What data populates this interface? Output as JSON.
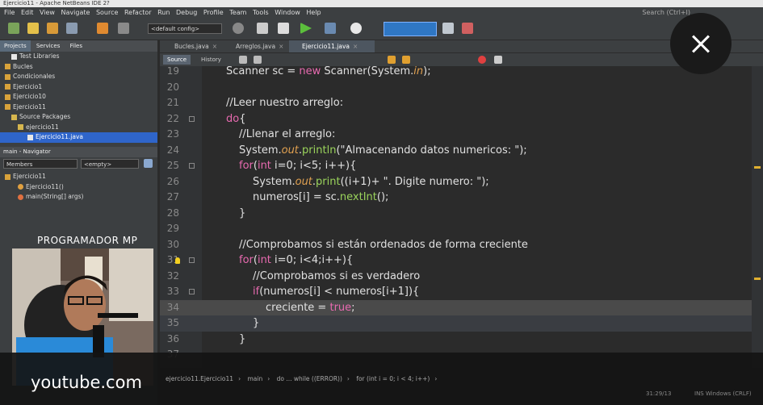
{
  "window": {
    "title": "Ejercicio11 - Apache NetBeans IDE 2?"
  },
  "menu": {
    "items": [
      "File",
      "Edit",
      "View",
      "Navigate",
      "Source",
      "Refactor",
      "Run",
      "Debug",
      "Profile",
      "Team",
      "Tools",
      "Window",
      "Help"
    ],
    "search_placeholder": "Search (Ctrl+I)"
  },
  "toolbar": {
    "config_value": "<default config>"
  },
  "projects_panel": {
    "tabs": [
      "Projects",
      "Services",
      "Files"
    ],
    "tree": [
      {
        "label": "Test Libraries",
        "type": "folder",
        "indent": 1
      },
      {
        "label": "Bucles",
        "type": "project",
        "indent": 0
      },
      {
        "label": "Condicionales",
        "type": "project",
        "indent": 0
      },
      {
        "label": "Ejercicio1",
        "type": "project",
        "indent": 0
      },
      {
        "label": "Ejercicio10",
        "type": "project",
        "indent": 0
      },
      {
        "label": "Ejercicio11",
        "type": "project",
        "indent": 0
      },
      {
        "label": "Source Packages",
        "type": "folder",
        "indent": 1
      },
      {
        "label": "ejercicio11",
        "type": "package",
        "indent": 2
      },
      {
        "label": "Ejercicio11.java",
        "type": "file",
        "indent": 3,
        "selected": true
      }
    ]
  },
  "navigator": {
    "title": "main - Navigator",
    "filter": "Members",
    "empty_filter": "<empty>",
    "tree": [
      {
        "label": "Ejercicio11",
        "indent": 0
      },
      {
        "label": "Ejercicio11()",
        "indent": 1
      },
      {
        "label": "main(String[] args)",
        "indent": 1
      }
    ]
  },
  "overlay": {
    "channel_name": "PROGRAMADOR MP",
    "youtube_label": "youtube.com"
  },
  "editor": {
    "tabs": [
      {
        "label": "Bucles.java",
        "active": false
      },
      {
        "label": "Arreglos.java",
        "active": false
      },
      {
        "label": "Ejercicio11.java",
        "active": true
      }
    ],
    "source_tab": "Source",
    "history_tab": "History",
    "lines": [
      {
        "n": "19",
        "text": "Scanner sc = new Scanner(System.in);"
      },
      {
        "n": "20",
        "text": ""
      },
      {
        "n": "21",
        "text": "//Leer nuestro arreglo:"
      },
      {
        "n": "22",
        "text": "do{"
      },
      {
        "n": "23",
        "text": "//Llenar el arreglo:"
      },
      {
        "n": "24",
        "text": "System.out.println(\"Almacenando datos numericos: \");"
      },
      {
        "n": "25",
        "text": "for(int i=0; i<5; i++){"
      },
      {
        "n": "26",
        "text": "System.out.print((i+1)+ \". Digite numero: \");"
      },
      {
        "n": "27",
        "text": "numeros[i] = sc.nextInt();"
      },
      {
        "n": "28",
        "text": "}"
      },
      {
        "n": "29",
        "text": ""
      },
      {
        "n": "30",
        "text": "//Comprobamos si están ordenados de forma creciente"
      },
      {
        "n": "31",
        "text": "for(int i=0; i<4;i++){"
      },
      {
        "n": "32",
        "text": "//Comprobamos si es verdadero"
      },
      {
        "n": "33",
        "text": "if(numeros[i] < numeros[i+1]){"
      },
      {
        "n": "34",
        "text": "creciente = true;"
      },
      {
        "n": "35",
        "text": "}"
      },
      {
        "n": "36",
        "text": "}"
      },
      {
        "n": "37",
        "text": ""
      }
    ]
  },
  "breadcrumb": [
    "ejercicio11.Ejercicio11",
    "main",
    "do ... while ((ERROR))",
    "for (int i = 0; i < 4; i++)"
  ],
  "status": {
    "position": "31:29/13",
    "mode": "INS  Windows (CRLF)"
  }
}
